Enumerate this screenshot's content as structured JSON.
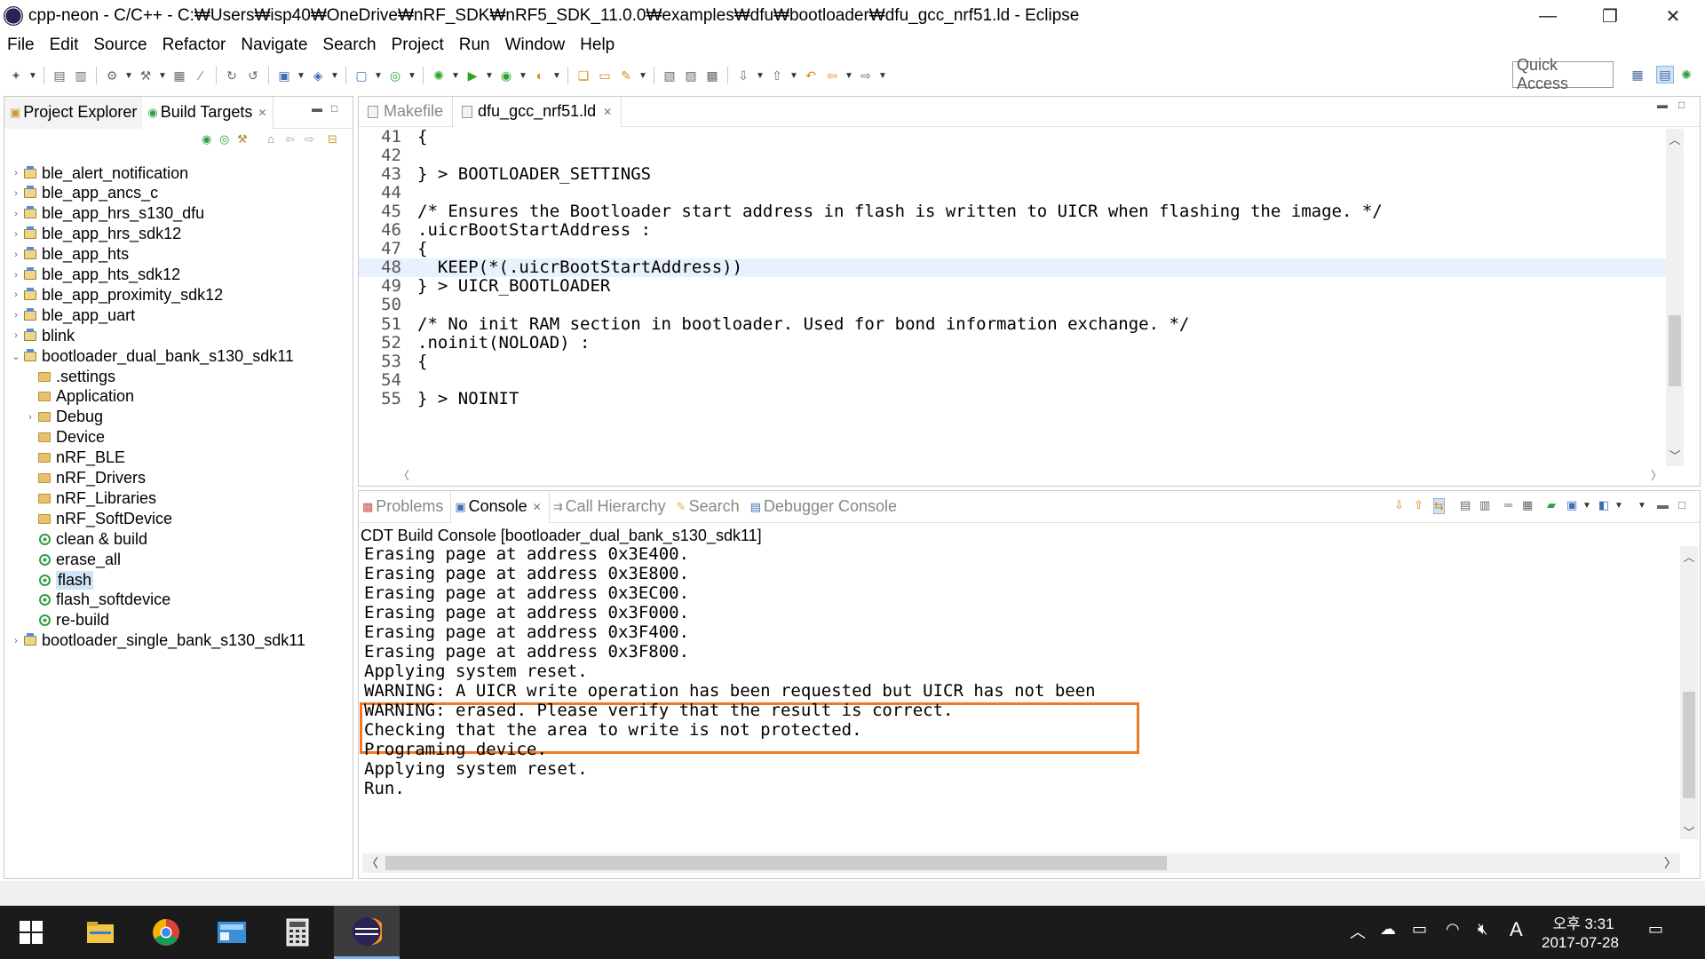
{
  "window": {
    "title": "cpp-neon - C/C++ - C:₩Users₩isp40₩OneDrive₩nRF_SDK₩nRF5_SDK_11.0.0₩examples₩dfu₩bootloader₩dfu_gcc_nrf51.ld - Eclipse",
    "minimize": "—",
    "maximize": "❐",
    "close": "✕"
  },
  "menu": [
    "File",
    "Edit",
    "Source",
    "Refactor",
    "Navigate",
    "Search",
    "Project",
    "Run",
    "Window",
    "Help"
  ],
  "toolbar": {
    "quick_access_placeholder": "Quick Access"
  },
  "left_panel": {
    "tabs": [
      {
        "label": "Project Explorer"
      },
      {
        "label": "Build Targets",
        "close": "✕"
      }
    ],
    "tree": [
      {
        "label": "ble_alert_notification",
        "kind": "project",
        "expand": "›"
      },
      {
        "label": "ble_app_ancs_c",
        "kind": "project",
        "expand": "›"
      },
      {
        "label": "ble_app_hrs_s130_dfu",
        "kind": "project",
        "expand": "›"
      },
      {
        "label": "ble_app_hrs_sdk12",
        "kind": "project",
        "expand": "›"
      },
      {
        "label": "ble_app_hts",
        "kind": "project",
        "expand": "›"
      },
      {
        "label": "ble_app_hts_sdk12",
        "kind": "project",
        "expand": "›"
      },
      {
        "label": "ble_app_proximity_sdk12",
        "kind": "project",
        "expand": "›"
      },
      {
        "label": "ble_app_uart",
        "kind": "project",
        "expand": "›"
      },
      {
        "label": "blink",
        "kind": "project",
        "expand": "›"
      },
      {
        "label": "bootloader_dual_bank_s130_sdk11",
        "kind": "project",
        "expand": "⌄"
      },
      {
        "label": ".settings",
        "kind": "folder",
        "expand": ""
      },
      {
        "label": "Application",
        "kind": "folder",
        "expand": ""
      },
      {
        "label": "Debug",
        "kind": "folder",
        "expand": "›"
      },
      {
        "label": "Device",
        "kind": "folder",
        "expand": ""
      },
      {
        "label": "nRF_BLE",
        "kind": "folder",
        "expand": ""
      },
      {
        "label": "nRF_Drivers",
        "kind": "folder",
        "expand": ""
      },
      {
        "label": "nRF_Libraries",
        "kind": "folder",
        "expand": ""
      },
      {
        "label": "nRF_SoftDevice",
        "kind": "folder",
        "expand": ""
      },
      {
        "label": "clean & build",
        "kind": "target",
        "expand": ""
      },
      {
        "label": "erase_all",
        "kind": "target",
        "expand": ""
      },
      {
        "label": "flash",
        "kind": "target",
        "expand": "",
        "selected": true
      },
      {
        "label": "flash_softdevice",
        "kind": "target",
        "expand": ""
      },
      {
        "label": "re-build",
        "kind": "target",
        "expand": ""
      },
      {
        "label": "bootloader_single_bank_s130_sdk11",
        "kind": "project",
        "expand": "›"
      }
    ]
  },
  "editor": {
    "tabs": [
      {
        "label": "Makefile"
      },
      {
        "label": "dfu_gcc_nrf51.ld",
        "close": "✕"
      }
    ],
    "lines": [
      {
        "n": "41",
        "text": "{"
      },
      {
        "n": "42",
        "text": ""
      },
      {
        "n": "43",
        "text": "} > BOOTLOADER_SETTINGS"
      },
      {
        "n": "44",
        "text": ""
      },
      {
        "n": "45",
        "text": "/* Ensures the Bootloader start address in flash is written to UICR when flashing the image. */"
      },
      {
        "n": "46",
        "text": ".uicrBootStartAddress :"
      },
      {
        "n": "47",
        "text": "{"
      },
      {
        "n": "48",
        "text": "  KEEP(*(.uicrBootStartAddress))",
        "current": true
      },
      {
        "n": "49",
        "text": "} > UICR_BOOTLOADER"
      },
      {
        "n": "50",
        "text": ""
      },
      {
        "n": "51",
        "text": "/* No init RAM section in bootloader. Used for bond information exchange. */"
      },
      {
        "n": "52",
        "text": ".noinit(NOLOAD) :"
      },
      {
        "n": "53",
        "text": "{"
      },
      {
        "n": "54",
        "text": ""
      },
      {
        "n": "55",
        "text": "} > NOINIT"
      }
    ]
  },
  "console": {
    "tabs": [
      {
        "label": "Problems"
      },
      {
        "label": "Console",
        "close": "✕"
      },
      {
        "label": "Call Hierarchy"
      },
      {
        "label": "Search"
      },
      {
        "label": "Debugger Console"
      }
    ],
    "title": "CDT Build Console [bootloader_dual_bank_s130_sdk11]",
    "lines": [
      "Erasing page at address 0x3E400.",
      "Erasing page at address 0x3E800.",
      "Erasing page at address 0x3EC00.",
      "Erasing page at address 0x3F000.",
      "Erasing page at address 0x3F400.",
      "Erasing page at address 0x3F800.",
      "Applying system reset.",
      "WARNING: A UICR write operation has been requested but UICR has not been",
      "WARNING: erased. Please verify that the result is correct.",
      "Checking that the area to write is not protected.",
      "Programing device.",
      "Applying system reset.",
      "Run."
    ],
    "highlight_color": "#ef7a26"
  },
  "taskbar": {
    "time": "오후 3:31",
    "date": "2017-07-28",
    "ime": "A"
  }
}
